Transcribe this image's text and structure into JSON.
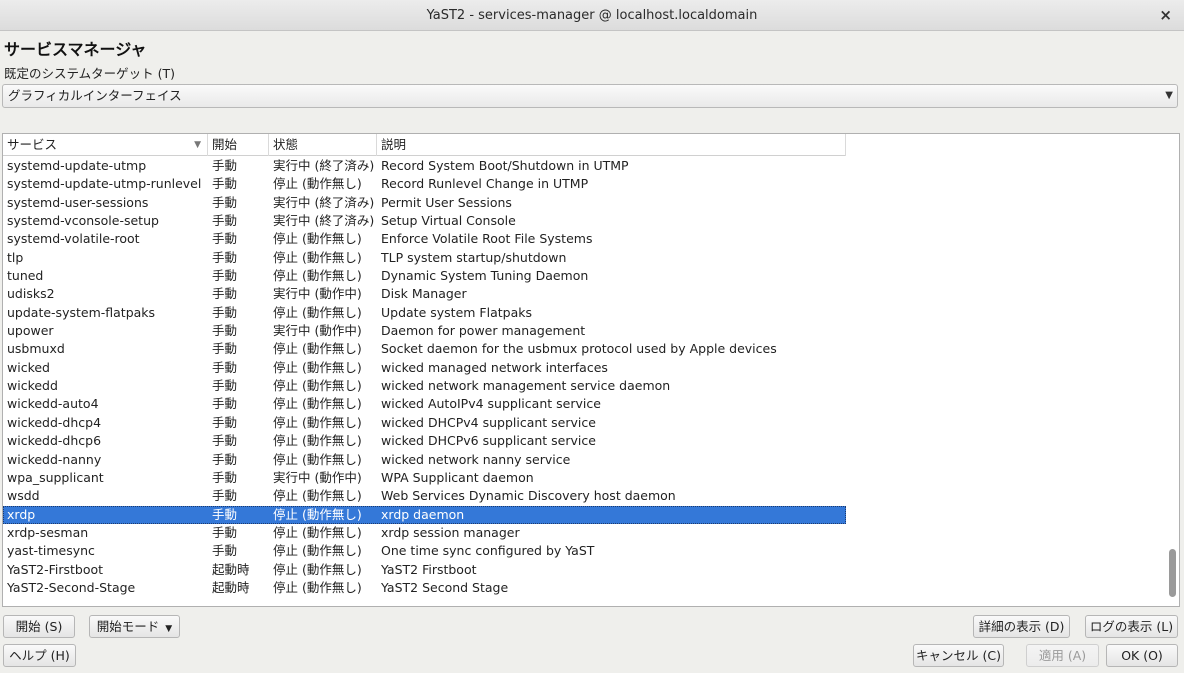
{
  "window": {
    "title": "YaST2 - services-manager @ localhost.localdomain",
    "close_glyph": "×"
  },
  "heading": "サービスマネージャ",
  "target": {
    "label": "既定のシステムターゲット (T)",
    "value": "グラフィカルインターフェイス",
    "arrow_icon": "▼"
  },
  "table": {
    "headers": {
      "service": "サービス",
      "start": "開始",
      "state": "状態",
      "description": "説明",
      "sort_icon": "▼"
    },
    "rows": [
      {
        "name": "systemd-update-utmp",
        "start": "手動",
        "state": "実行中 (終了済み)",
        "desc": "Record System Boot/Shutdown in UTMP"
      },
      {
        "name": "systemd-update-utmp-runlevel",
        "start": "手動",
        "state": "停止 (動作無し)",
        "desc": "Record Runlevel Change in UTMP"
      },
      {
        "name": "systemd-user-sessions",
        "start": "手動",
        "state": "実行中 (終了済み)",
        "desc": "Permit User Sessions"
      },
      {
        "name": "systemd-vconsole-setup",
        "start": "手動",
        "state": "実行中 (終了済み)",
        "desc": "Setup Virtual Console"
      },
      {
        "name": "systemd-volatile-root",
        "start": "手動",
        "state": "停止 (動作無し)",
        "desc": "Enforce Volatile Root File Systems"
      },
      {
        "name": "tlp",
        "start": "手動",
        "state": "停止 (動作無し)",
        "desc": "TLP system startup/shutdown"
      },
      {
        "name": "tuned",
        "start": "手動",
        "state": "停止 (動作無し)",
        "desc": "Dynamic System Tuning Daemon"
      },
      {
        "name": "udisks2",
        "start": "手動",
        "state": "実行中 (動作中)",
        "desc": "Disk Manager"
      },
      {
        "name": "update-system-flatpaks",
        "start": "手動",
        "state": "停止 (動作無し)",
        "desc": "Update system Flatpaks"
      },
      {
        "name": "upower",
        "start": "手動",
        "state": "実行中 (動作中)",
        "desc": "Daemon for power management"
      },
      {
        "name": "usbmuxd",
        "start": "手動",
        "state": "停止 (動作無し)",
        "desc": "Socket daemon for the usbmux protocol used by Apple devices"
      },
      {
        "name": "wicked",
        "start": "手動",
        "state": "停止 (動作無し)",
        "desc": "wicked managed network interfaces"
      },
      {
        "name": "wickedd",
        "start": "手動",
        "state": "停止 (動作無し)",
        "desc": "wicked network management service daemon"
      },
      {
        "name": "wickedd-auto4",
        "start": "手動",
        "state": "停止 (動作無し)",
        "desc": "wicked AutoIPv4 supplicant service"
      },
      {
        "name": "wickedd-dhcp4",
        "start": "手動",
        "state": "停止 (動作無し)",
        "desc": "wicked DHCPv4 supplicant service"
      },
      {
        "name": "wickedd-dhcp6",
        "start": "手動",
        "state": "停止 (動作無し)",
        "desc": "wicked DHCPv6 supplicant service"
      },
      {
        "name": "wickedd-nanny",
        "start": "手動",
        "state": "停止 (動作無し)",
        "desc": "wicked network nanny service"
      },
      {
        "name": "wpa_supplicant",
        "start": "手動",
        "state": "実行中 (動作中)",
        "desc": "WPA Supplicant daemon"
      },
      {
        "name": "wsdd",
        "start": "手動",
        "state": "停止 (動作無し)",
        "desc": "Web Services Dynamic Discovery host daemon"
      },
      {
        "name": "xrdp",
        "start": "手動",
        "state": "停止 (動作無し)",
        "desc": "xrdp daemon",
        "selected": true
      },
      {
        "name": "xrdp-sesman",
        "start": "手動",
        "state": "停止 (動作無し)",
        "desc": "xrdp session manager"
      },
      {
        "name": "yast-timesync",
        "start": "手動",
        "state": "停止 (動作無し)",
        "desc": "One time sync configured by YaST"
      },
      {
        "name": "YaST2-Firstboot",
        "start": "起動時",
        "state": "停止 (動作無し)",
        "desc": "YaST2 Firstboot"
      },
      {
        "name": "YaST2-Second-Stage",
        "start": "起動時",
        "state": "停止 (動作無し)",
        "desc": "YaST2 Second Stage"
      }
    ]
  },
  "buttons": {
    "start": "開始 (S)",
    "start_mode": "開始モード",
    "start_mode_icon": "▼",
    "show_details": "詳細の表示 (D)",
    "show_log": "ログの表示 (L)",
    "help": "ヘルプ (H)",
    "cancel": "キャンセル (C)",
    "apply": "適用 (A)",
    "ok": "OK (O)"
  },
  "colors": {
    "selection": "#3478d8",
    "window_bg": "#efefec"
  }
}
